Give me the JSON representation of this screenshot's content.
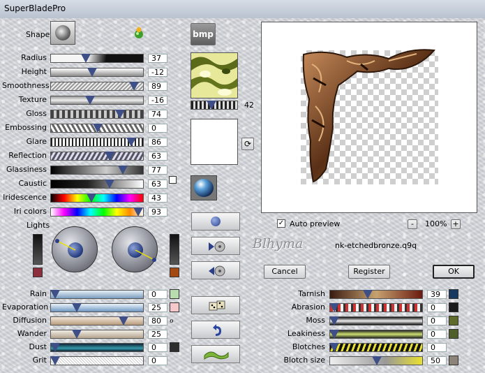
{
  "window": {
    "title": "SuperBladePro"
  },
  "shape": {
    "label": "Shape"
  },
  "bmp_button": {
    "label": "bmp"
  },
  "sliders": [
    {
      "label": "Radius",
      "value": "37",
      "fraction": 0.37
    },
    {
      "label": "Height",
      "value": "-12",
      "fraction": 0.44
    },
    {
      "label": "Smoothness",
      "value": "89",
      "fraction": 0.89
    },
    {
      "label": "Texture",
      "value": "-16",
      "fraction": 0.42
    },
    {
      "label": "Gloss",
      "value": "74",
      "fraction": 0.74
    },
    {
      "label": "Embossing",
      "value": "0",
      "fraction": 0.5
    },
    {
      "label": "Glare",
      "value": "86",
      "fraction": 0.86
    },
    {
      "label": "Reflection",
      "value": "63",
      "fraction": 0.63
    },
    {
      "label": "Glassiness",
      "value": "77",
      "fraction": 0.77
    },
    {
      "label": "Caustic",
      "value": "63",
      "fraction": 0.63
    },
    {
      "label": "Iridescence",
      "value": "43",
      "fraction": 0.43
    },
    {
      "label": "Iri colors",
      "value": "93",
      "fraction": 0.93
    }
  ],
  "texture_slider": {
    "value": "42",
    "fraction": 0.42
  },
  "lights": {
    "label": "Lights",
    "left_color": "#8b2f3c",
    "right_color": "#a34a12"
  },
  "watermark": {
    "text": "Blhyma"
  },
  "preset_name": "nk-etchedbronze.q9q",
  "auto_preview": {
    "label": "Auto preview",
    "checked": true
  },
  "zoom": {
    "value": "100%",
    "minus": "-",
    "plus": "+"
  },
  "buttons": {
    "cancel": "Cancel",
    "register": "Register",
    "ok": "OK"
  },
  "bottom_left_sliders": [
    {
      "label": "Rain",
      "value": "0",
      "fraction": 0.0,
      "swatch": "#b9dcae"
    },
    {
      "label": "Evaporation",
      "value": "25",
      "fraction": 0.25,
      "swatch": "#f5c9c9"
    },
    {
      "label": "Diffusion",
      "value": "80",
      "fraction": 0.8
    },
    {
      "label": "Wander",
      "value": "25",
      "fraction": 0.25
    },
    {
      "label": "Dust",
      "value": "0",
      "fraction": 0.0,
      "swatch": "#2e2e2e"
    },
    {
      "label": "Grit",
      "value": "0",
      "fraction": 0.0
    }
  ],
  "bottom_right_sliders": [
    {
      "label": "Tarnish",
      "value": "39",
      "fraction": 0.39,
      "swatch": "#17385f"
    },
    {
      "label": "Abrasion",
      "value": "0",
      "fraction": 0.0,
      "swatch": "#1b1b1b"
    },
    {
      "label": "Moss",
      "value": "0",
      "fraction": 0.0,
      "swatch": "#5e6b2b"
    },
    {
      "label": "Leakiness",
      "value": "0",
      "fraction": 0.0,
      "swatch": "#4f5f2a"
    },
    {
      "label": "Blotches",
      "value": "0",
      "fraction": 0.0
    },
    {
      "label": "Blotch size",
      "value": "50",
      "fraction": 0.5,
      "swatch": "#8d8479"
    }
  ]
}
